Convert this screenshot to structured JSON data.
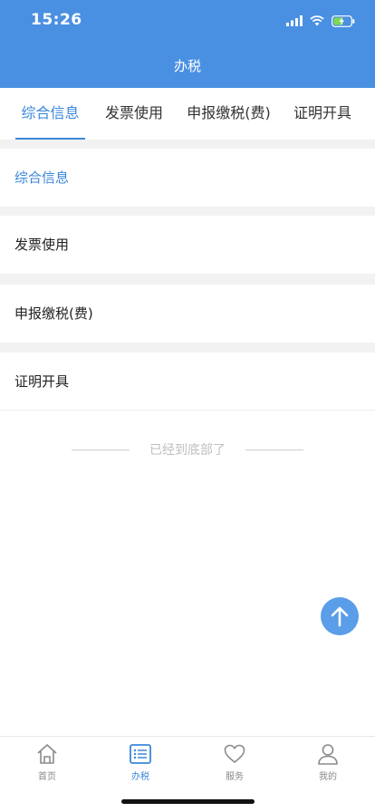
{
  "status_bar": {
    "time": "15:26"
  },
  "header": {
    "title": "办税"
  },
  "tabs": [
    {
      "label": "综合信息",
      "active": true
    },
    {
      "label": "发票使用",
      "active": false
    },
    {
      "label": "申报缴税(费)",
      "active": false
    },
    {
      "label": "证明开具",
      "active": false
    }
  ],
  "sections": [
    {
      "label": "综合信息",
      "active": true
    },
    {
      "label": "发票使用",
      "active": false
    },
    {
      "label": "申报缴税(费)",
      "active": false
    },
    {
      "label": "证明开具",
      "active": false
    }
  ],
  "end_text": "已经到底部了",
  "bottom_nav": [
    {
      "label": "首页",
      "icon": "home-icon",
      "active": false
    },
    {
      "label": "办税",
      "icon": "list-icon",
      "active": true
    },
    {
      "label": "服务",
      "icon": "heart-icon",
      "active": false
    },
    {
      "label": "我的",
      "icon": "user-icon",
      "active": false
    }
  ],
  "colors": {
    "accent": "#4a90e2",
    "active_text": "#3b87d9",
    "background_gap": "#f2f2f2"
  }
}
